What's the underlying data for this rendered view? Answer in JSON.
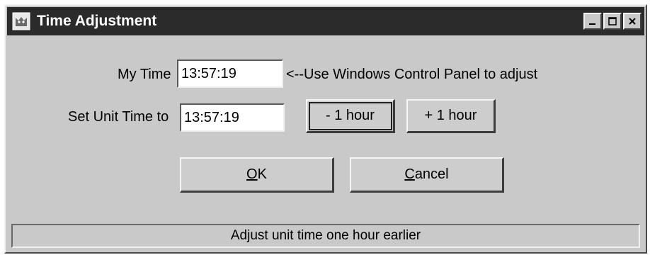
{
  "window": {
    "title": "Time Adjustment",
    "icon": "kitty-cat-icon",
    "controls": [
      "minimize-icon",
      "maximize-icon",
      "close-icon"
    ]
  },
  "form": {
    "my_time_label": "My Time",
    "my_time_value": "13:57:19",
    "my_time_hint": "<--Use Windows Control Panel to adjust",
    "unit_time_label": "Set Unit Time to",
    "unit_time_value": "13:57:19",
    "minus_hour_label": "- 1 hour",
    "plus_hour_label": "+ 1 hour"
  },
  "actions": {
    "ok_mnemonic": "O",
    "ok_rest": "K",
    "cancel_mnemonic": "C",
    "cancel_rest": "ancel"
  },
  "status": {
    "text": "Adjust unit time one hour earlier"
  },
  "colors": {
    "titlebar": "#2b2b2b",
    "face": "#c9c9c9",
    "field": "#ffffff"
  }
}
